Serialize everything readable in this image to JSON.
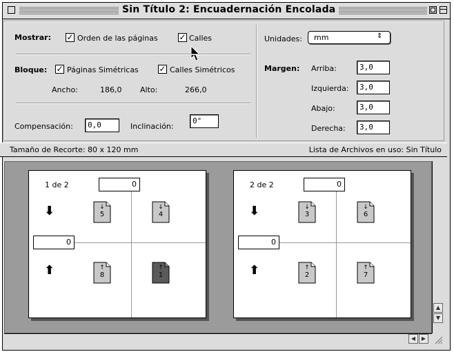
{
  "window": {
    "title": "Sin Título 2: Encuadernación Encolada"
  },
  "mostrar": {
    "label": "Mostrar:",
    "orden_label": "Orden de las páginas",
    "orden_checked": true,
    "calles_label": "Calles",
    "calles_checked": true
  },
  "bloque": {
    "label": "Bloque:",
    "paginas_label": "Páginas Simétricas",
    "paginas_checked": true,
    "calles_label": "Calles Simétricos",
    "calles_checked": true,
    "ancho_label": "Ancho:",
    "ancho_value": "186,0",
    "alto_label": "Alto:",
    "alto_value": "266,0"
  },
  "compensacion": {
    "label": "Compensación:",
    "value": "0,0"
  },
  "inclinacion": {
    "label": "Inclinación:",
    "value": "0°"
  },
  "unidades": {
    "label": "Unidades:",
    "value": "mm"
  },
  "margen": {
    "label": "Margen:",
    "arriba_label": "Arriba:",
    "arriba_value": "3,0",
    "izquierda_label": "Izquierda:",
    "izquierda_value": "3,0",
    "abajo_label": "Abajo:",
    "abajo_value": "3,0",
    "derecha_label": "Derecha:",
    "derecha_value": "3,0"
  },
  "status": {
    "recorte": "Tamaño de Recorte: 80 x 120 mm",
    "archivos": "Lista de Archivos en uso: Sin Título"
  },
  "spreads": [
    {
      "label": "1 de 2",
      "top_value": "0",
      "side_value": "0",
      "top_pages": [
        "5",
        "4"
      ],
      "bottom_pages": [
        "8",
        "1"
      ]
    },
    {
      "label": "2 de 2",
      "top_value": "0",
      "side_value": "0",
      "top_pages": [
        "3",
        "6"
      ],
      "bottom_pages": [
        "2",
        "7"
      ]
    }
  ],
  "colors": {
    "window_bg": "#dcdcdc",
    "canvas_bg": "#9b9b9b",
    "selected_page": "#5a5a5a"
  },
  "icons": [
    "zoom-box-icon",
    "collapse-box-icon",
    "close-box-icon",
    "mouse-cursor-icon",
    "arrow-down-icon",
    "arrow-up-icon",
    "page-icon",
    "scroll-up-icon",
    "scroll-down-icon",
    "scroll-left-icon",
    "scroll-right-icon",
    "resize-grip-icon"
  ]
}
